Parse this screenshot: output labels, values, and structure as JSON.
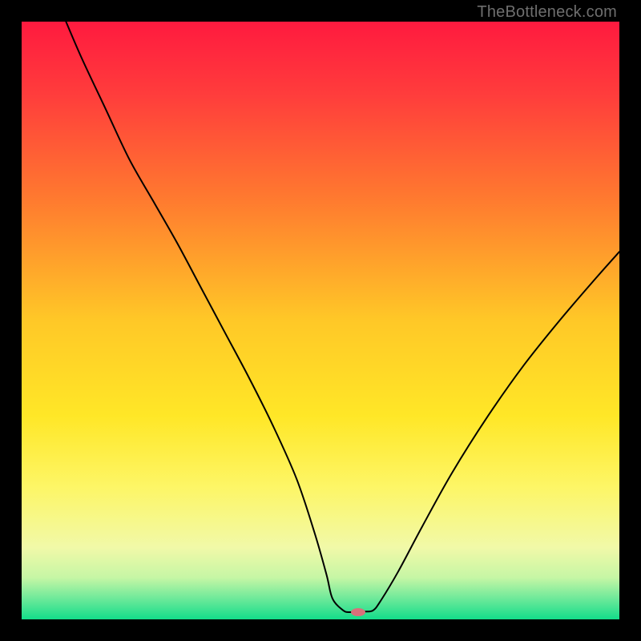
{
  "attribution": "TheBottleneck.com",
  "chart_data": {
    "type": "line",
    "title": "",
    "xlabel": "",
    "ylabel": "",
    "xlim": [
      0,
      100
    ],
    "ylim": [
      0,
      100
    ],
    "background_gradient_stops": [
      {
        "offset": 0.0,
        "color": "#ff1a3f"
      },
      {
        "offset": 0.12,
        "color": "#ff3c3c"
      },
      {
        "offset": 0.3,
        "color": "#ff7b2f"
      },
      {
        "offset": 0.5,
        "color": "#ffc827"
      },
      {
        "offset": 0.66,
        "color": "#ffe727"
      },
      {
        "offset": 0.78,
        "color": "#fdf667"
      },
      {
        "offset": 0.88,
        "color": "#f1f9a8"
      },
      {
        "offset": 0.93,
        "color": "#c6f6a5"
      },
      {
        "offset": 0.965,
        "color": "#6ee99a"
      },
      {
        "offset": 1.0,
        "color": "#13dd8a"
      }
    ],
    "series": [
      {
        "name": "bottleneck-curve",
        "color": "#000000",
        "width": 2,
        "x": [
          7,
          10,
          14,
          18,
          22,
          26,
          30,
          34,
          38,
          42,
          46,
          49,
          51,
          52.0,
          53.8,
          55,
          57.5,
          58.8,
          60,
          63,
          67,
          72,
          78,
          84,
          90,
          96,
          100
        ],
        "y": [
          101,
          94,
          85.5,
          77,
          70,
          63,
          55.5,
          48,
          40.5,
          32.5,
          23.5,
          14.5,
          7.5,
          3.5,
          1.5,
          1.2,
          1.3,
          1.5,
          3.0,
          8.0,
          15.5,
          24.5,
          34.0,
          42.5,
          50.0,
          57.0,
          61.5
        ]
      }
    ],
    "marker": {
      "name": "optimum-marker",
      "x": 56.3,
      "y": 1.2,
      "rx": 9,
      "ry": 5,
      "fill": "#d9707a"
    }
  }
}
